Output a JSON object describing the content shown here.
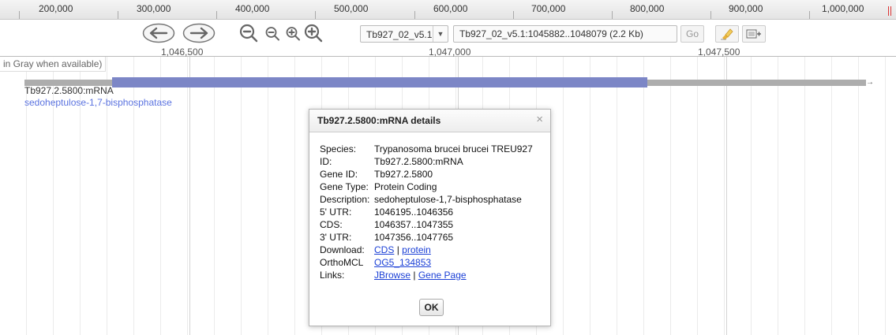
{
  "overview": {
    "labels": [
      "200,000",
      "300,000",
      "400,000",
      "500,000",
      "600,000",
      "700,000",
      "800,000",
      "900,000",
      "1,000,000"
    ]
  },
  "toolbar": {
    "sequence_select": "Tb927_02_v5.1",
    "location_value": "Tb927_02_v5.1:1045882..1048079 (2.2 Kb)",
    "go_label": "Go"
  },
  "detail_ruler": {
    "labels": [
      "1,046,500",
      "1,047,000",
      "1,047,500"
    ]
  },
  "track": {
    "label": "in Gray when available)",
    "feature_name": "Tb927.2.5800:mRNA",
    "feature_description": "sedoheptulose-1,7-bisphosphatase",
    "colors": {
      "utr": "#adadad",
      "cds": "#7c86c6"
    }
  },
  "dialog": {
    "title": "Tb927.2.5800:mRNA details",
    "close_glyph": "×",
    "species_label": "Species:",
    "species_value": "Trypanosoma brucei brucei TREU927",
    "id_label": "ID:",
    "id_value": "Tb927.2.5800:mRNA",
    "gene_id_label": "Gene ID:",
    "gene_id_value": "Tb927.2.5800",
    "gene_type_label": "Gene Type:",
    "gene_type_value": "Protein Coding",
    "description_label": "Description:",
    "description_value": "sedoheptulose-1,7-bisphosphatase",
    "utr5_label": "5' UTR:",
    "utr5_value": "1046195..1046356",
    "cds_label": "CDS:",
    "cds_value": "1046357..1047355",
    "utr3_label": "3' UTR:",
    "utr3_value": "1047356..1047765",
    "download_label": "Download:",
    "download_cds": "CDS",
    "download_sep": "|",
    "download_protein": "protein",
    "orthomcl_label": "OrthoMCL",
    "orthomcl_value": "OG5_134853",
    "links_label": "Links:",
    "links_jbrowse": "JBrowse",
    "links_sep": "|",
    "links_gene_page": "Gene Page",
    "ok_label": "OK"
  }
}
